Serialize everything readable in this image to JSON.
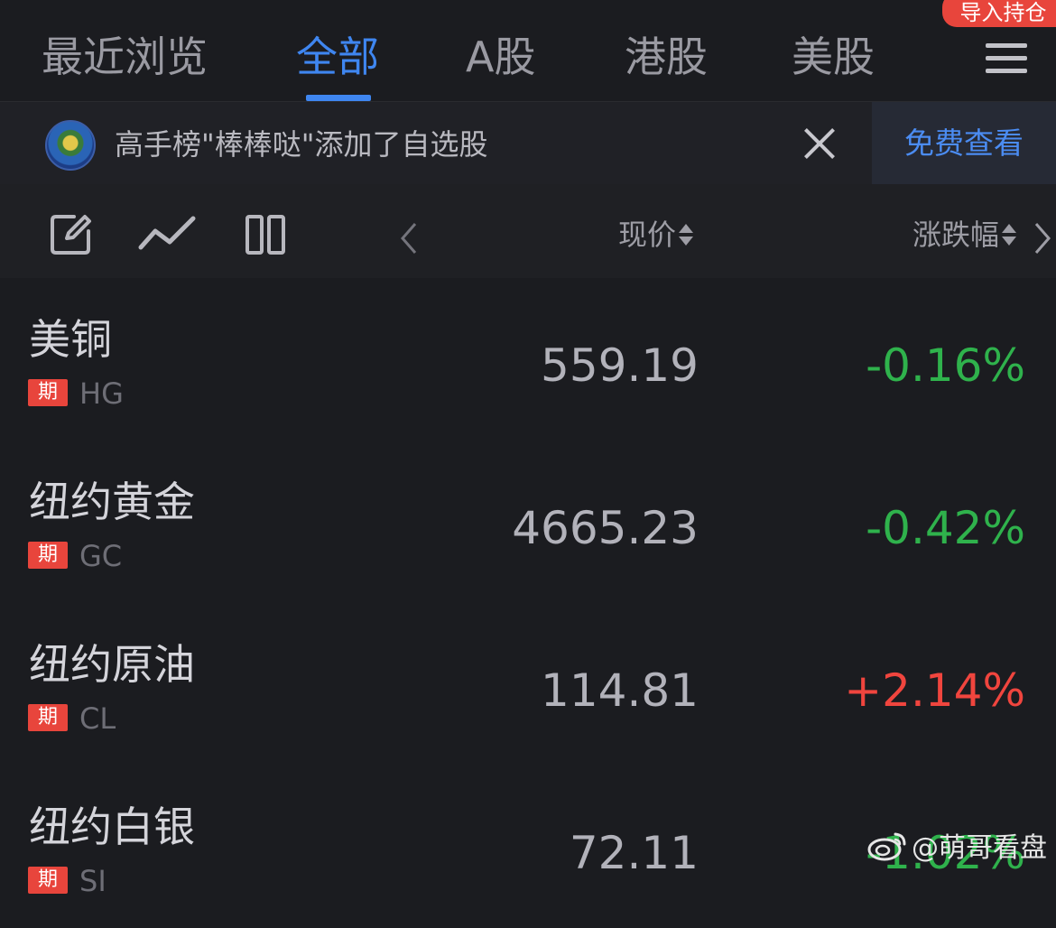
{
  "tabs": [
    {
      "label": "最近浏览",
      "active": false
    },
    {
      "label": "全部",
      "active": true
    },
    {
      "label": "A股",
      "active": false
    },
    {
      "label": "港股",
      "active": false
    },
    {
      "label": "美股",
      "active": false
    }
  ],
  "header": {
    "import_label": "导入持仓",
    "menu_icon": "hamburger-menu-icon"
  },
  "notice": {
    "text": "高手榜\"棒棒哒\"添加了自选股",
    "action_label": "免费查看",
    "close_icon": "close-icon"
  },
  "columns": {
    "price_label": "现价",
    "change_label": "涨跌幅"
  },
  "colors": {
    "accent": "#3f86f0",
    "down": "#2fb24c",
    "up": "#f0453e",
    "badge": "#e8453c"
  },
  "rows": [
    {
      "name": "美铜",
      "tag": "期",
      "code": "HG",
      "price": "559.19",
      "change": "-0.16%",
      "direction": "down"
    },
    {
      "name": "纽约黄金",
      "tag": "期",
      "code": "GC",
      "price": "4665.23",
      "change": "-0.42%",
      "direction": "down"
    },
    {
      "name": "纽约原油",
      "tag": "期",
      "code": "CL",
      "price": "114.81",
      "change": "+2.14%",
      "direction": "up"
    },
    {
      "name": "纽约白银",
      "tag": "期",
      "code": "SI",
      "price": "72.11",
      "change": "-1.02%",
      "direction": "down"
    }
  ],
  "watermark": {
    "text": "@萌哥看盘"
  }
}
